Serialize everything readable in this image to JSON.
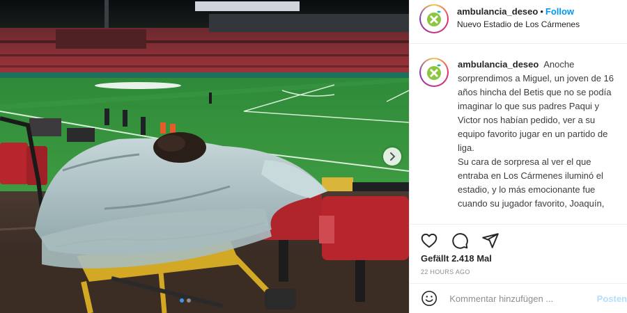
{
  "post": {
    "username": "ambulancia_deseo",
    "separator": "•",
    "follow_label": "Follow",
    "location": "Nuevo Estadio de Los Cármenes",
    "caption": "Anoche sorprendimos a Miguel, un joven de 16 años hincha del Betis que no se podía imaginar lo que sus padres Paqui y Victor nos habían pedido, ver a su equipo favorito jugar en un partido de liga.\nSu cara de sorpresa al ver el que entraba en Los Cármenes iluminó el estadio, y lo más emocionante fue cuando su jugador favorito, Joaquín,",
    "likes": "Gefällt 2.418 Mal",
    "timestamp": "22 HOURS AGO"
  },
  "comment_box": {
    "placeholder": "Kommentar hinzufügen ...",
    "post_label": "Posten"
  },
  "carousel": {
    "slide_count": 2,
    "active_index": 0
  },
  "icons": {
    "like": "heart-icon",
    "comment": "comment-bubble-icon",
    "share": "paper-plane-icon",
    "emoji": "smiley-icon",
    "next": "chevron-right-icon",
    "avatar_logo": "ambulance-heart-logo"
  },
  "colors": {
    "link_blue": "#0095f6",
    "post_disabled": "#b2dffc",
    "logo_green": "#8cc63f",
    "logo_teal": "#29b3a6"
  }
}
